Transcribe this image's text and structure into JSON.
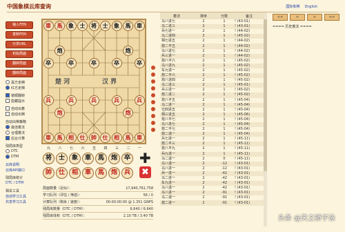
{
  "header": {
    "title": "中国象棋云库查询",
    "links": [
      "国际象棋",
      "English"
    ]
  },
  "left_buttons": [
    "输入FEN",
    "复制FEN",
    "分享URL",
    "初始局面",
    "翻转局面",
    "翻转局面"
  ],
  "left_options": [
    {
      "type": "radio",
      "label": "黑方走棋",
      "on": false
    },
    {
      "type": "radio",
      "label": "红方走棋",
      "on": true
    },
    {
      "type": "gap"
    },
    {
      "type": "check",
      "label": "镜顺翻转",
      "on": true
    },
    {
      "type": "check",
      "label": "隐藏提示",
      "on": false
    },
    {
      "type": "gap"
    },
    {
      "type": "check",
      "label": "自动出着",
      "on": false
    },
    {
      "type": "check",
      "label": "自动出棋",
      "on": false
    },
    {
      "type": "gap"
    },
    {
      "type": "label",
      "label": "自动出棋策略"
    },
    {
      "type": "radio",
      "label": "最佳着法",
      "on": true
    },
    {
      "type": "radio",
      "label": "合理着法",
      "on": false
    },
    {
      "type": "check",
      "label": "后台计算",
      "on": true
    },
    {
      "type": "gap"
    },
    {
      "type": "label",
      "label": "残局库类型"
    },
    {
      "type": "radio",
      "label": "DTC",
      "on": false
    },
    {
      "type": "radio",
      "label": "DTM",
      "on": true
    },
    {
      "type": "gap"
    },
    {
      "type": "link",
      "label": "云库说明"
    },
    {
      "type": "link",
      "label": "云库API接口"
    },
    {
      "type": "gap"
    },
    {
      "type": "label",
      "label": "残局库统计"
    },
    {
      "type": "link",
      "label": "DTC / DTM"
    },
    {
      "type": "gap"
    },
    {
      "type": "label",
      "label": "相关工具"
    },
    {
      "type": "link",
      "label": "自动学习工具"
    },
    {
      "type": "link",
      "label": "共享学习工具"
    }
  ],
  "board": {
    "river_left": "楚    河",
    "river_right": "汉    界",
    "files_bottom": [
      "九",
      "八",
      "七",
      "六",
      "五",
      "四",
      "三",
      "二",
      "一"
    ],
    "pieces": [
      {
        "ch": "車",
        "side": "r",
        "c": 0,
        "rw": 0
      },
      {
        "ch": "馬",
        "side": "r",
        "c": 1,
        "rw": 0
      },
      {
        "ch": "象",
        "side": "b",
        "c": 2,
        "rw": 0
      },
      {
        "ch": "士",
        "side": "b",
        "c": 3,
        "rw": 0
      },
      {
        "ch": "将",
        "side": "b",
        "c": 4,
        "rw": 0
      },
      {
        "ch": "士",
        "side": "b",
        "c": 5,
        "rw": 0
      },
      {
        "ch": "象",
        "side": "b",
        "c": 6,
        "rw": 0
      },
      {
        "ch": "馬",
        "side": "b",
        "c": 7,
        "rw": 0
      },
      {
        "ch": "車",
        "side": "b",
        "c": 8,
        "rw": 0
      },
      {
        "ch": "炮",
        "side": "b",
        "c": 1,
        "rw": 2
      },
      {
        "ch": "炮",
        "side": "b",
        "c": 7,
        "rw": 2
      },
      {
        "ch": "卒",
        "side": "b",
        "c": 0,
        "rw": 3
      },
      {
        "ch": "卒",
        "side": "b",
        "c": 2,
        "rw": 3
      },
      {
        "ch": "卒",
        "side": "b",
        "c": 4,
        "rw": 3
      },
      {
        "ch": "卒",
        "side": "b",
        "c": 6,
        "rw": 3
      },
      {
        "ch": "卒",
        "side": "b",
        "c": 8,
        "rw": 3
      },
      {
        "ch": "兵",
        "side": "r",
        "c": 0,
        "rw": 6
      },
      {
        "ch": "兵",
        "side": "r",
        "c": 2,
        "rw": 6
      },
      {
        "ch": "兵",
        "side": "r",
        "c": 4,
        "rw": 6
      },
      {
        "ch": "兵",
        "side": "r",
        "c": 6,
        "rw": 6
      },
      {
        "ch": "兵",
        "side": "r",
        "c": 8,
        "rw": 6
      },
      {
        "ch": "炮",
        "side": "r",
        "c": 1,
        "rw": 7
      },
      {
        "ch": "炮",
        "side": "r",
        "c": 7,
        "rw": 7
      },
      {
        "ch": "車",
        "side": "r",
        "c": 0,
        "rw": 9
      },
      {
        "ch": "馬",
        "side": "r",
        "c": 1,
        "rw": 9
      },
      {
        "ch": "相",
        "side": "r",
        "c": 2,
        "rw": 9
      },
      {
        "ch": "仕",
        "side": "r",
        "c": 3,
        "rw": 9
      },
      {
        "ch": "帥",
        "side": "r",
        "c": 4,
        "rw": 9
      },
      {
        "ch": "仕",
        "side": "r",
        "c": 5,
        "rw": 9
      },
      {
        "ch": "相",
        "side": "r",
        "c": 6,
        "rw": 9
      },
      {
        "ch": "馬",
        "side": "r",
        "c": 7,
        "rw": 9
      },
      {
        "ch": "車",
        "side": "r",
        "c": 8,
        "rw": 9
      }
    ]
  },
  "palette": [
    {
      "ch": "将",
      "side": "b"
    },
    {
      "ch": "士",
      "side": "b"
    },
    {
      "ch": "象",
      "side": "b"
    },
    {
      "ch": "車",
      "side": "b"
    },
    {
      "ch": "馬",
      "side": "b"
    },
    {
      "ch": "炮",
      "side": "b"
    },
    {
      "ch": "卒",
      "side": "b"
    },
    {
      "ch": "帥",
      "side": "r"
    },
    {
      "ch": "仕",
      "side": "r"
    },
    {
      "ch": "相",
      "side": "r"
    },
    {
      "ch": "車",
      "side": "r"
    },
    {
      "ch": "馬",
      "side": "r"
    },
    {
      "ch": "炮",
      "side": "r"
    },
    {
      "ch": "兵",
      "side": "r"
    }
  ],
  "stats": [
    {
      "label": "局面数量（近似）：",
      "value": "17,940,761,758"
    },
    {
      "label": "学习队列（评估 / 筛选）：",
      "value": "56 / 0"
    },
    {
      "label": "计算队列（剩余 / 速度）：",
      "value": "00:00:00:00 @ 1.351 GNPS"
    },
    {
      "label": "残局库数量（DTC / DTM）：",
      "value": "6,640 / 6,640"
    },
    {
      "label": "残局库体积（DTC / DTM）：",
      "value": "2.10 TB / 3.40 TB"
    }
  ],
  "table": {
    "headers": [
      "着法",
      "排序",
      "分数",
      "备注"
    ],
    "rows": [
      [
        "马八进七",
        "2",
        "1",
        "! (43-01)"
      ],
      [
        "马二进三",
        "2",
        "1",
        "! (43-01)"
      ],
      [
        "兵七进一",
        "2",
        "1",
        "! (44-02)"
      ],
      [
        "马二进四",
        "2",
        "1",
        "! (45-02)"
      ],
      [
        "相七进五",
        "2",
        "1",
        "! (44-02)"
      ],
      [
        "炮二平五",
        "2",
        "1",
        "! (44-02)"
      ],
      [
        "马八进七",
        "2",
        "1",
        "! (44-02)"
      ],
      [
        "兵三进一",
        "2",
        "1",
        "! (44-02)"
      ],
      [
        "炮八平六",
        "2",
        "1",
        "! (45-02)"
      ],
      [
        "马八进九",
        "2",
        "1",
        "! (45-02)"
      ],
      [
        "车九进一",
        "2",
        "1",
        "! (45-02)"
      ],
      [
        "炮二平六",
        "2",
        "1",
        "! (45-02)"
      ],
      [
        "炮八进四",
        "2",
        "1",
        "! (45-02)"
      ],
      [
        "马二进三",
        "2",
        "1",
        "! (45-01)"
      ],
      [
        "兵三进一",
        "2",
        "1",
        "! (45-02)"
      ],
      [
        "炮二进二",
        "2",
        "1",
        "! (45-02)"
      ],
      [
        "炮八平五",
        "2",
        "1",
        "! (45-04)"
      ],
      [
        "马二进一",
        "2",
        "1",
        "! (45-04)"
      ],
      [
        "仕四进五",
        "2",
        "1",
        "! (45-04)"
      ],
      [
        "相三进五",
        "2",
        "1",
        "! (45-06)"
      ],
      [
        "炮八平七",
        "2",
        "1",
        "! (45-04)"
      ],
      [
        "马八进七",
        "2",
        "1",
        "! (45-04)"
      ],
      [
        "炮二平七",
        "2",
        "1",
        "! (45-04)"
      ],
      [
        "炮二退一",
        "2",
        "1",
        "! (45-04)"
      ],
      [
        "兵七进一",
        "2",
        "1",
        "! (45-11)"
      ],
      [
        "炮二平三",
        "2",
        "1",
        "! (45-11)"
      ],
      [
        "炮八平九",
        "2",
        "1",
        "! (45-11)"
      ],
      [
        "兵九进一",
        "2",
        "1",
        "! (45-11)"
      ],
      [
        "马二退一",
        "2",
        "0",
        "! (45-11)"
      ],
      [
        "马八退一",
        "2",
        "-12",
        "! (43-01)"
      ],
      [
        "马八进一",
        "2",
        "-12",
        "! (43-01)"
      ],
      [
        "兵一进一",
        "2",
        "-42",
        "! (43-01)"
      ],
      [
        "马二进一",
        "2",
        "-42",
        "! (43-01)"
      ],
      [
        "车九进一",
        "2",
        "-42",
        "! (43-01)"
      ],
      [
        "马八退一",
        "2",
        "-42",
        "! (43-01)"
      ],
      [
        "马八进一",
        "2",
        "-91",
        "! (43-01)"
      ],
      [
        "马二退一",
        "2",
        "-91",
        "! (43-01)"
      ],
      [
        "炮二进一",
        "2",
        "-91",
        "! (43-01)"
      ]
    ]
  },
  "nav": {
    "buttons": [
      "<<",
      "<",
      ">",
      ">>"
    ],
    "history_label": "==== 历史着法 ===="
  },
  "watermark": "头条 @天之骄子泳"
}
